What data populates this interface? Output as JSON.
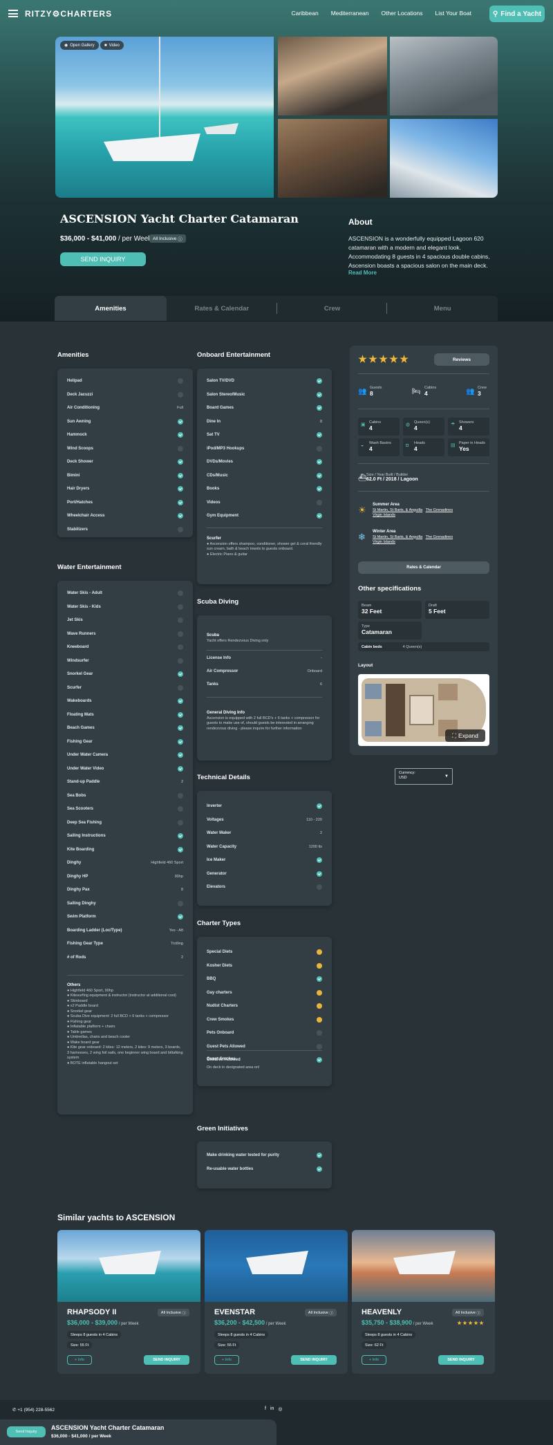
{
  "nav": {
    "logo": "RITZY⚙CHARTERS",
    "links": [
      "Caribbean",
      "Mediterranean",
      "Other Locations",
      "List Your Boat"
    ],
    "cta": "Find a Yacht"
  },
  "gallery": {
    "open_label": "Open Gallery",
    "video_label": "Video"
  },
  "hero": {
    "title": "ASCENSION Yacht Charter Catamaran",
    "price": "$36,000 - $41,000",
    "per": " / per Week",
    "badge": "All Inclusive",
    "inquiry": "SEND INQUIRY"
  },
  "about": {
    "heading": "About",
    "text": "ASCENSION is a wonderfully equipped Lagoon 620 catamaran with a modern and elegant look. Accommodating 8 guests in 4 spacious double cabins, Ascension boasts a spacious salon on the main deck.",
    "more": "Read More"
  },
  "tabs": [
    "Amenities",
    "Rates & Calendar",
    "Crew",
    "Menu"
  ],
  "amenities": {
    "heading": "Amenities",
    "rows": [
      {
        "label": "Helipad",
        "status": "n"
      },
      {
        "label": "Deck Jacuzzi",
        "status": "n"
      },
      {
        "label": "Air Conditioning",
        "value": "Full"
      },
      {
        "label": "Sun Awning",
        "status": "y"
      },
      {
        "label": "Hammock",
        "status": "y"
      },
      {
        "label": "Wind Scoops",
        "status": "n"
      },
      {
        "label": "Deck Shower",
        "status": "y"
      },
      {
        "label": "Bimini",
        "status": "y"
      },
      {
        "label": "Hair Dryers",
        "status": "y"
      },
      {
        "label": "Port/Hatches",
        "status": "y"
      },
      {
        "label": "Wheelchair Access",
        "status": "y"
      },
      {
        "label": "Stabilizers",
        "status": "n"
      }
    ]
  },
  "water": {
    "heading": "Water Entertainment",
    "rows": [
      {
        "label": "Water Skis - Adult",
        "status": "n"
      },
      {
        "label": "Water Skis - Kids",
        "status": "n"
      },
      {
        "label": "Jet Skis",
        "status": "n"
      },
      {
        "label": "Wave Runners",
        "status": "n"
      },
      {
        "label": "Kneeboard",
        "status": "n"
      },
      {
        "label": "Windsurfer",
        "status": "n"
      },
      {
        "label": "Snorkel Gear",
        "status": "y"
      },
      {
        "label": "Scurfer",
        "status": "n"
      },
      {
        "label": "Wakeboards",
        "status": "y"
      },
      {
        "label": "Floating Mats",
        "status": "y"
      },
      {
        "label": "Beach Games",
        "status": "y"
      },
      {
        "label": "Fishing Gear",
        "status": "y"
      },
      {
        "label": "Under Water Camera",
        "status": "y"
      },
      {
        "label": "Under Water Video",
        "status": "y"
      },
      {
        "label": "Stand-up Paddle",
        "value": "2"
      },
      {
        "label": "Sea Bobs",
        "status": "n"
      },
      {
        "label": "Sea Scooters",
        "status": "n"
      },
      {
        "label": "Deep Sea Fishing",
        "status": "n"
      },
      {
        "label": "Sailing Instructions",
        "status": "y"
      },
      {
        "label": "Kite Boarding",
        "status": "y"
      },
      {
        "label": "Dinghy",
        "value": "Highfield 460 Sport"
      },
      {
        "label": "Dinghy HP",
        "value": "90hp"
      },
      {
        "label": "Dinghy Pax",
        "value": "8"
      },
      {
        "label": "Sailing Dinghy",
        "status": "n"
      },
      {
        "label": "Swim Platform",
        "status": "y"
      },
      {
        "label": "Boarding Ladder (Loc/Type)",
        "value": "Yes - Aft"
      },
      {
        "label": "Fishing Gear Type",
        "value": "Trolling"
      },
      {
        "label": "# of Rods",
        "value": "2"
      }
    ],
    "others_title": "Others",
    "others": [
      "● Highfield 460 Sport, 90hp",
      "● Kitesurfing equipment & instructor (instructor at additional cost)",
      "● Skinboard",
      "● x2 Paddle board",
      "● Snorkel gear",
      "● Scuba Dive equipment: 2 full BCD + 6 tanks + compressor",
      "● Fishing gear",
      "● Inflatable platform + chairs",
      "● Table games",
      "● Umbrellas, chairs and beach cooler",
      "● Wake board gear",
      "● Kite gear onboard: 2 kites: 12 meters, 2 kites: 9 meters, 3 boards, 3 harnesses, 2 wing foil sails, one beginner wing board and bittalking system",
      "● BOTE inflatable hangout set"
    ]
  },
  "onboard": {
    "heading": "Onboard Entertainment",
    "rows": [
      {
        "label": "Salon TV/DVD",
        "status": "y"
      },
      {
        "label": "Salon Stereo/Music",
        "status": "y"
      },
      {
        "label": "Board Games",
        "status": "y"
      },
      {
        "label": "Dine In",
        "value": "8"
      },
      {
        "label": "Sat TV",
        "status": "y"
      },
      {
        "label": "iPod/MP3 Hookups",
        "status": "n"
      },
      {
        "label": "DVDs/Movies",
        "status": "y"
      },
      {
        "label": "CDs/Music",
        "status": "y"
      },
      {
        "label": "Books",
        "status": "y"
      },
      {
        "label": "Videos",
        "status": "n"
      },
      {
        "label": "Gym Equipment",
        "status": "y"
      }
    ],
    "note_title": "Scurfer",
    "note": "● Ascension offers shampoo, conditioner, shower gel & coral friendly sun cream, bath & beach towels to guests onboard.",
    "note2": "● Electric Piano & guitar"
  },
  "scuba": {
    "heading": "Scuba Diving",
    "title": "Scuba",
    "subtitle": "Yacht offers Rendezvous Diving only",
    "rows": [
      {
        "label": "License Info",
        "value": "-"
      },
      {
        "label": "Air Compressor",
        "value": "Onboard"
      },
      {
        "label": "Tanks",
        "value": "6"
      }
    ],
    "info_title": "General Diving Info",
    "info": "Ascension is equipped with 2 full BCD's + 6 tanks + compressor for guests to make use of, should guests be interested in arranging rendezvous diving - please inquire for further information"
  },
  "technical": {
    "heading": "Technical Details",
    "rows": [
      {
        "label": "Inverter",
        "status": "y"
      },
      {
        "label": "Voltages",
        "value": "110 - 220"
      },
      {
        "label": "Water Maker",
        "value": "2"
      },
      {
        "label": "Water Capacity",
        "value": "1200 lts"
      },
      {
        "label": "Ice Maker",
        "status": "y"
      },
      {
        "label": "Generator",
        "status": "y"
      },
      {
        "label": "Elevators",
        "status": "n"
      }
    ]
  },
  "charter": {
    "heading": "Charter Types",
    "rows": [
      {
        "label": "Special Diets",
        "status": "o"
      },
      {
        "label": "Kosher Diets",
        "status": "o"
      },
      {
        "label": "BBQ",
        "status": "y"
      },
      {
        "label": "Gay charters",
        "status": "o"
      },
      {
        "label": "Nudist Charters",
        "status": "o"
      },
      {
        "label": "Crew Smokes",
        "status": "o"
      },
      {
        "label": "Pets Onboard",
        "status": "n"
      },
      {
        "label": "Guest Pets Allowed",
        "status": "n"
      },
      {
        "label": "Children Allowed",
        "status": "y"
      }
    ],
    "smoke_title": "Guest Smokes",
    "smoke": "On deck in designated area on!"
  },
  "green": {
    "heading": "Green Initiatives",
    "rows": [
      {
        "label": "Make drinking water tested for purity",
        "status": "y"
      },
      {
        "label": "Re-usable water bottles",
        "status": "y"
      }
    ]
  },
  "side": {
    "reviews": "Reviews",
    "guests_label": "Guests",
    "guests": "8",
    "cabins_label": "Cabins",
    "cabins": "4",
    "crew_label": "Crew",
    "crew": "3",
    "cabin_label": "Cabins",
    "cabin": "4",
    "queen_label": "Queen(s)",
    "queen": "4",
    "showers_label": "Showers",
    "showers": "4",
    "wash_label": "Wash Basins",
    "wash": "4",
    "heads_label": "Heads",
    "heads": "4",
    "paper_label": "Paper in Heads",
    "paper": "Yes",
    "size_label": "Size / Year Built / Builder",
    "size": "62.0 Ft / 2018 / Lagoon",
    "summer_label": "Summer Area",
    "summer_1": "St Martin, St Barts, & Anguilla",
    "summer_2": "The Grenadines",
    "summer_3": "Virgin Islands",
    "winter_label": "Winter Area",
    "winter_1": "St Martin, St Barts, & Anguilla",
    "winter_2": "The Grenadines",
    "winter_3": "Virgin Islands",
    "rates_btn": "Rates & Calendar",
    "other_heading": "Other specifications",
    "beam_label": "Beam",
    "beam": "32 Feet",
    "draft_label": "Draft",
    "draft": "5 Feet",
    "type_label": "Type",
    "type": "Catamaran",
    "cabinbeds_label": "Cabin beds",
    "cabinbeds": "4 Queen(s)",
    "layout_heading": "Layout",
    "expand": "Expand"
  },
  "currency": {
    "label": "Currency:",
    "value": "USD"
  },
  "similar": {
    "heading": "Similar yachts to ASCENSION",
    "cards": [
      {
        "name": "RHAPSODY II",
        "badge": "All Inclusive",
        "price": "$36,000 - $39,000",
        "per": " / per Week",
        "sleeps": "Sleeps 8 guests in 4 Cabins",
        "size": "Size: 55 Ft",
        "info": "+ Info",
        "inquiry": "SEND INQUIRY"
      },
      {
        "name": "EVENSTAR",
        "badge": "All Inclusive",
        "price": "$36,200 - $42,500",
        "per": " / per Week",
        "sleeps": "Sleeps 8 guests in 4 Cabins",
        "size": "Size: 55 Ft",
        "info": "+ Info",
        "inquiry": "SEND INQUIRY"
      },
      {
        "name": "HEAVENLY",
        "badge": "All Inclusive",
        "price": "$35,750 - $38,900",
        "per": " / per Week",
        "sleeps": "Sleeps 8 guests in 4 Cabins",
        "size": "Size: 62 Ft",
        "info": "+ Info",
        "inquiry": "SEND INQUIRY"
      }
    ]
  },
  "footer": {
    "phone": "+1 (954) 228-5562"
  },
  "sticky": {
    "button": "Send Inquiry",
    "title": "ASCENSION Yacht Charter Catamaran",
    "price": "$36,000 - $41,000 / per Week"
  },
  "colors": {
    "accent": "#4fbfb5",
    "background": "#283237",
    "panel": "#323e44",
    "star": "#f0b93a"
  }
}
